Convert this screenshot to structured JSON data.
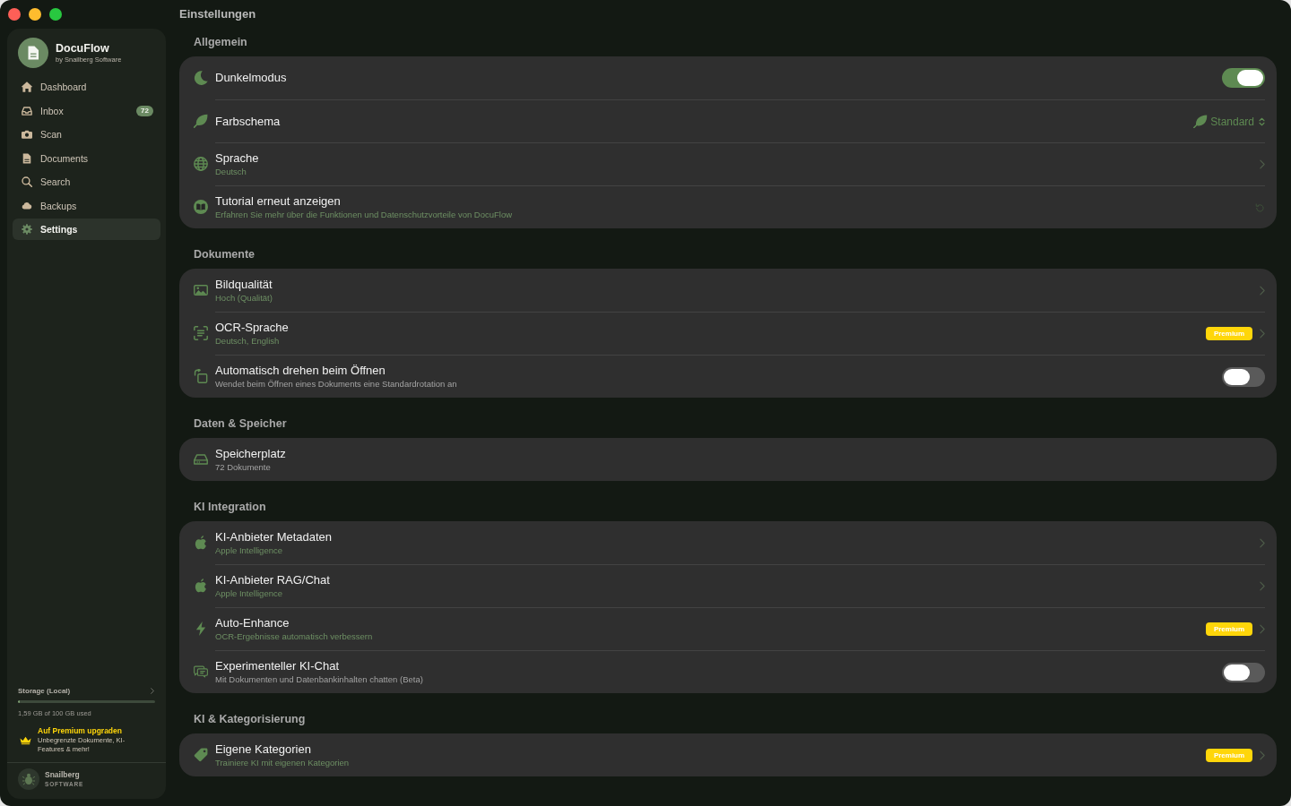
{
  "window": {
    "title": "Einstellungen"
  },
  "sidebar": {
    "app_name": "DocuFlow",
    "app_byline": "by Snailberg Software",
    "items": [
      {
        "label": "Dashboard",
        "selected": false
      },
      {
        "label": "Inbox",
        "selected": false,
        "badge": "72"
      },
      {
        "label": "Scan",
        "selected": false
      },
      {
        "label": "Documents",
        "selected": false
      },
      {
        "label": "Search",
        "selected": false
      },
      {
        "label": "Backups",
        "selected": false
      },
      {
        "label": "Settings",
        "selected": true
      }
    ],
    "storage": {
      "label": "Storage (Local)",
      "level": 0.016,
      "usage": "1,59 GB of 100 GB used"
    },
    "upgrade": {
      "title": "Auf Premium upgraden",
      "text": "Unbegrenzte Dokumente, KI-Features & mehr!"
    },
    "vendor": {
      "name": "Snailberg",
      "tagline": "SOFTWARE"
    }
  },
  "sections": [
    {
      "title": "Allgemein",
      "rows": [
        {
          "kind": "toggle",
          "title": "Dunkelmodus",
          "on": true
        },
        {
          "kind": "picker",
          "title": "Farbschema",
          "value": "Standard"
        },
        {
          "kind": "link",
          "title": "Sprache",
          "subtitle": "Deutsch",
          "tinted": true
        },
        {
          "kind": "action",
          "title": "Tutorial erneut anzeigen",
          "subtitle": "Erfahren Sie mehr über die Funktionen und Datenschutzvorteile von DocuFlow",
          "tinted": true
        }
      ]
    },
    {
      "title": "Dokumente",
      "rows": [
        {
          "kind": "link",
          "title": "Bildqualität",
          "subtitle": "Hoch (Qualität)",
          "tinted": true
        },
        {
          "kind": "link",
          "title": "OCR-Sprache",
          "subtitle": "Deutsch, English",
          "tinted": true,
          "badge": "Premium"
        },
        {
          "kind": "toggle",
          "title": "Automatisch drehen beim Öffnen",
          "subtitle": "Wendet beim Öffnen eines Dokuments eine Standardrotation an",
          "tinted": false,
          "on": false
        }
      ]
    },
    {
      "title": "Daten & Speicher",
      "rows": [
        {
          "kind": "info",
          "title": "Speicherplatz",
          "subtitle": "72 Dokumente",
          "tinted": false
        }
      ]
    },
    {
      "title": "KI Integration",
      "rows": [
        {
          "kind": "link",
          "title": "KI-Anbieter Metadaten",
          "subtitle": "Apple Intelligence",
          "tinted": true
        },
        {
          "kind": "link",
          "title": "KI-Anbieter RAG/Chat",
          "subtitle": "Apple Intelligence",
          "tinted": true
        },
        {
          "kind": "link",
          "title": "Auto-Enhance",
          "subtitle": "OCR-Ergebnisse automatisch verbessern",
          "tinted": true,
          "badge": "Premium"
        },
        {
          "kind": "toggle",
          "title": "Experimenteller KI-Chat",
          "subtitle": "Mit Dokumenten und Datenbankinhalten chatten (Beta)",
          "tinted": false,
          "on": false
        }
      ]
    },
    {
      "title": "KI & Kategorisierung",
      "rows": [
        {
          "kind": "link",
          "title": "Eigene Kategorien",
          "subtitle": "Trainiere KI mit eigenen Kategorien",
          "tinted": true,
          "badge": "Premium"
        }
      ]
    }
  ]
}
